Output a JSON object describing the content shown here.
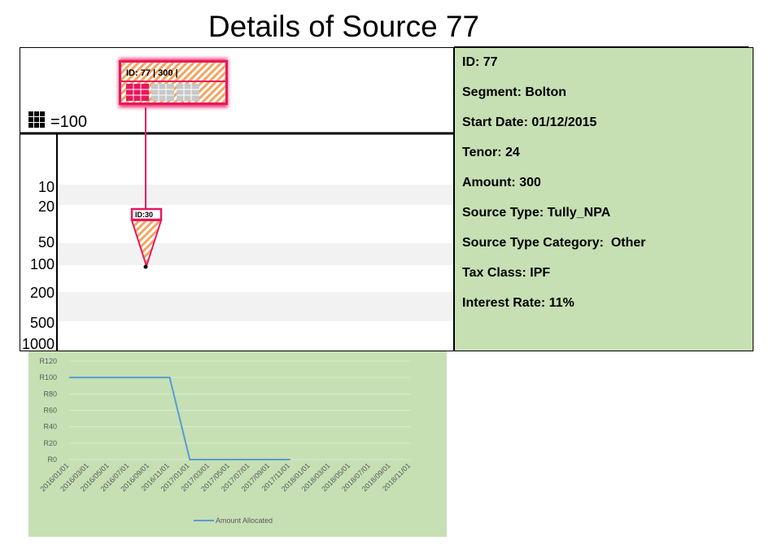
{
  "page": {
    "title": "Details of Source 77"
  },
  "diagram": {
    "legend_label": "=100",
    "scale_labels": [
      "10",
      "20",
      "50",
      "100",
      "200",
      "500",
      "1000"
    ],
    "source_box_label": "ID: 77 | 300 |",
    "marker_label": "ID:30",
    "colors": {
      "highlight": "#e8175d",
      "hatch": "#f4a460",
      "band": "#f2f2f2",
      "cell_empty": "#c8c8c8"
    }
  },
  "details": {
    "lines": [
      "ID: 77",
      "Segment: Bolton",
      "Start Date: 01/12/2015",
      "Tenor: 24",
      "Amount: 300",
      "Source Type: Tully_NPA",
      "Source Type Category:  Other",
      "Tax Class: IPF",
      "Interest Rate: 11%"
    ],
    "background": "#c6e0b4"
  },
  "chart_data": {
    "type": "line",
    "title": "",
    "xlabel": "",
    "ylabel": "",
    "categories": [
      "2016/01/01",
      "2016/03/01",
      "2016/05/01",
      "2016/07/01",
      "2016/09/01",
      "2016/11/01",
      "2017/01/01",
      "2017/03/01",
      "2017/05/01",
      "2017/07/01",
      "2017/09/01",
      "2017/11/01",
      "2018/01/01",
      "2018/03/01",
      "2018/05/01",
      "2018/07/01",
      "2018/09/01",
      "2018/11/01"
    ],
    "y_tick_labels": [
      "R0",
      "R20",
      "R40",
      "R60",
      "R80",
      "R100",
      "R120"
    ],
    "ylim": [
      0,
      120
    ],
    "grid": true,
    "legend_position": "bottom",
    "series": [
      {
        "name": "Amount Allocated",
        "color": "#5b9bd5",
        "values": [
          100,
          100,
          100,
          100,
          100,
          100,
          0,
          0,
          0,
          0,
          0,
          0,
          null,
          null,
          null,
          null,
          null,
          null
        ]
      }
    ]
  }
}
